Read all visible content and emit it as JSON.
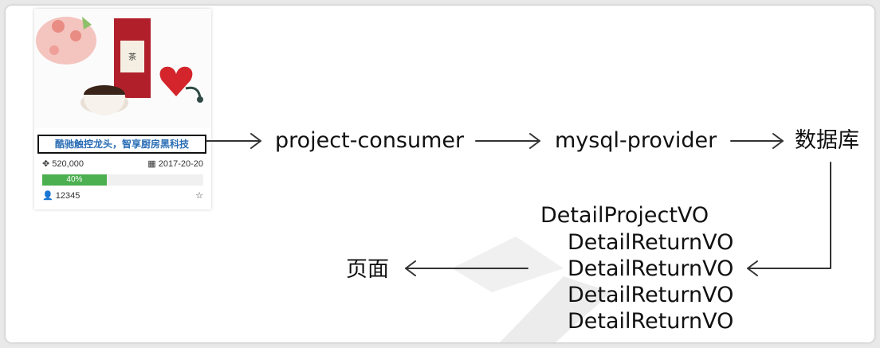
{
  "card": {
    "title": "酷驰触控龙头，智享厨房黑科技",
    "amount": "520,000",
    "date": "2017-20-20",
    "progress_text": "40%",
    "progress_value": 0.4,
    "supporters": "12345"
  },
  "flow": {
    "consumer": "project-consumer",
    "provider": "mysql-provider",
    "database": "数据库",
    "page": "页面",
    "vo_list": [
      "DetailProjectVO",
      "DetailReturnVO",
      "DetailReturnVO",
      "DetailReturnVO",
      "DetailReturnVO"
    ]
  },
  "colors": {
    "title_text": "#2a6db5",
    "progress_fill": "#4caf50",
    "arrow": "#333333"
  }
}
